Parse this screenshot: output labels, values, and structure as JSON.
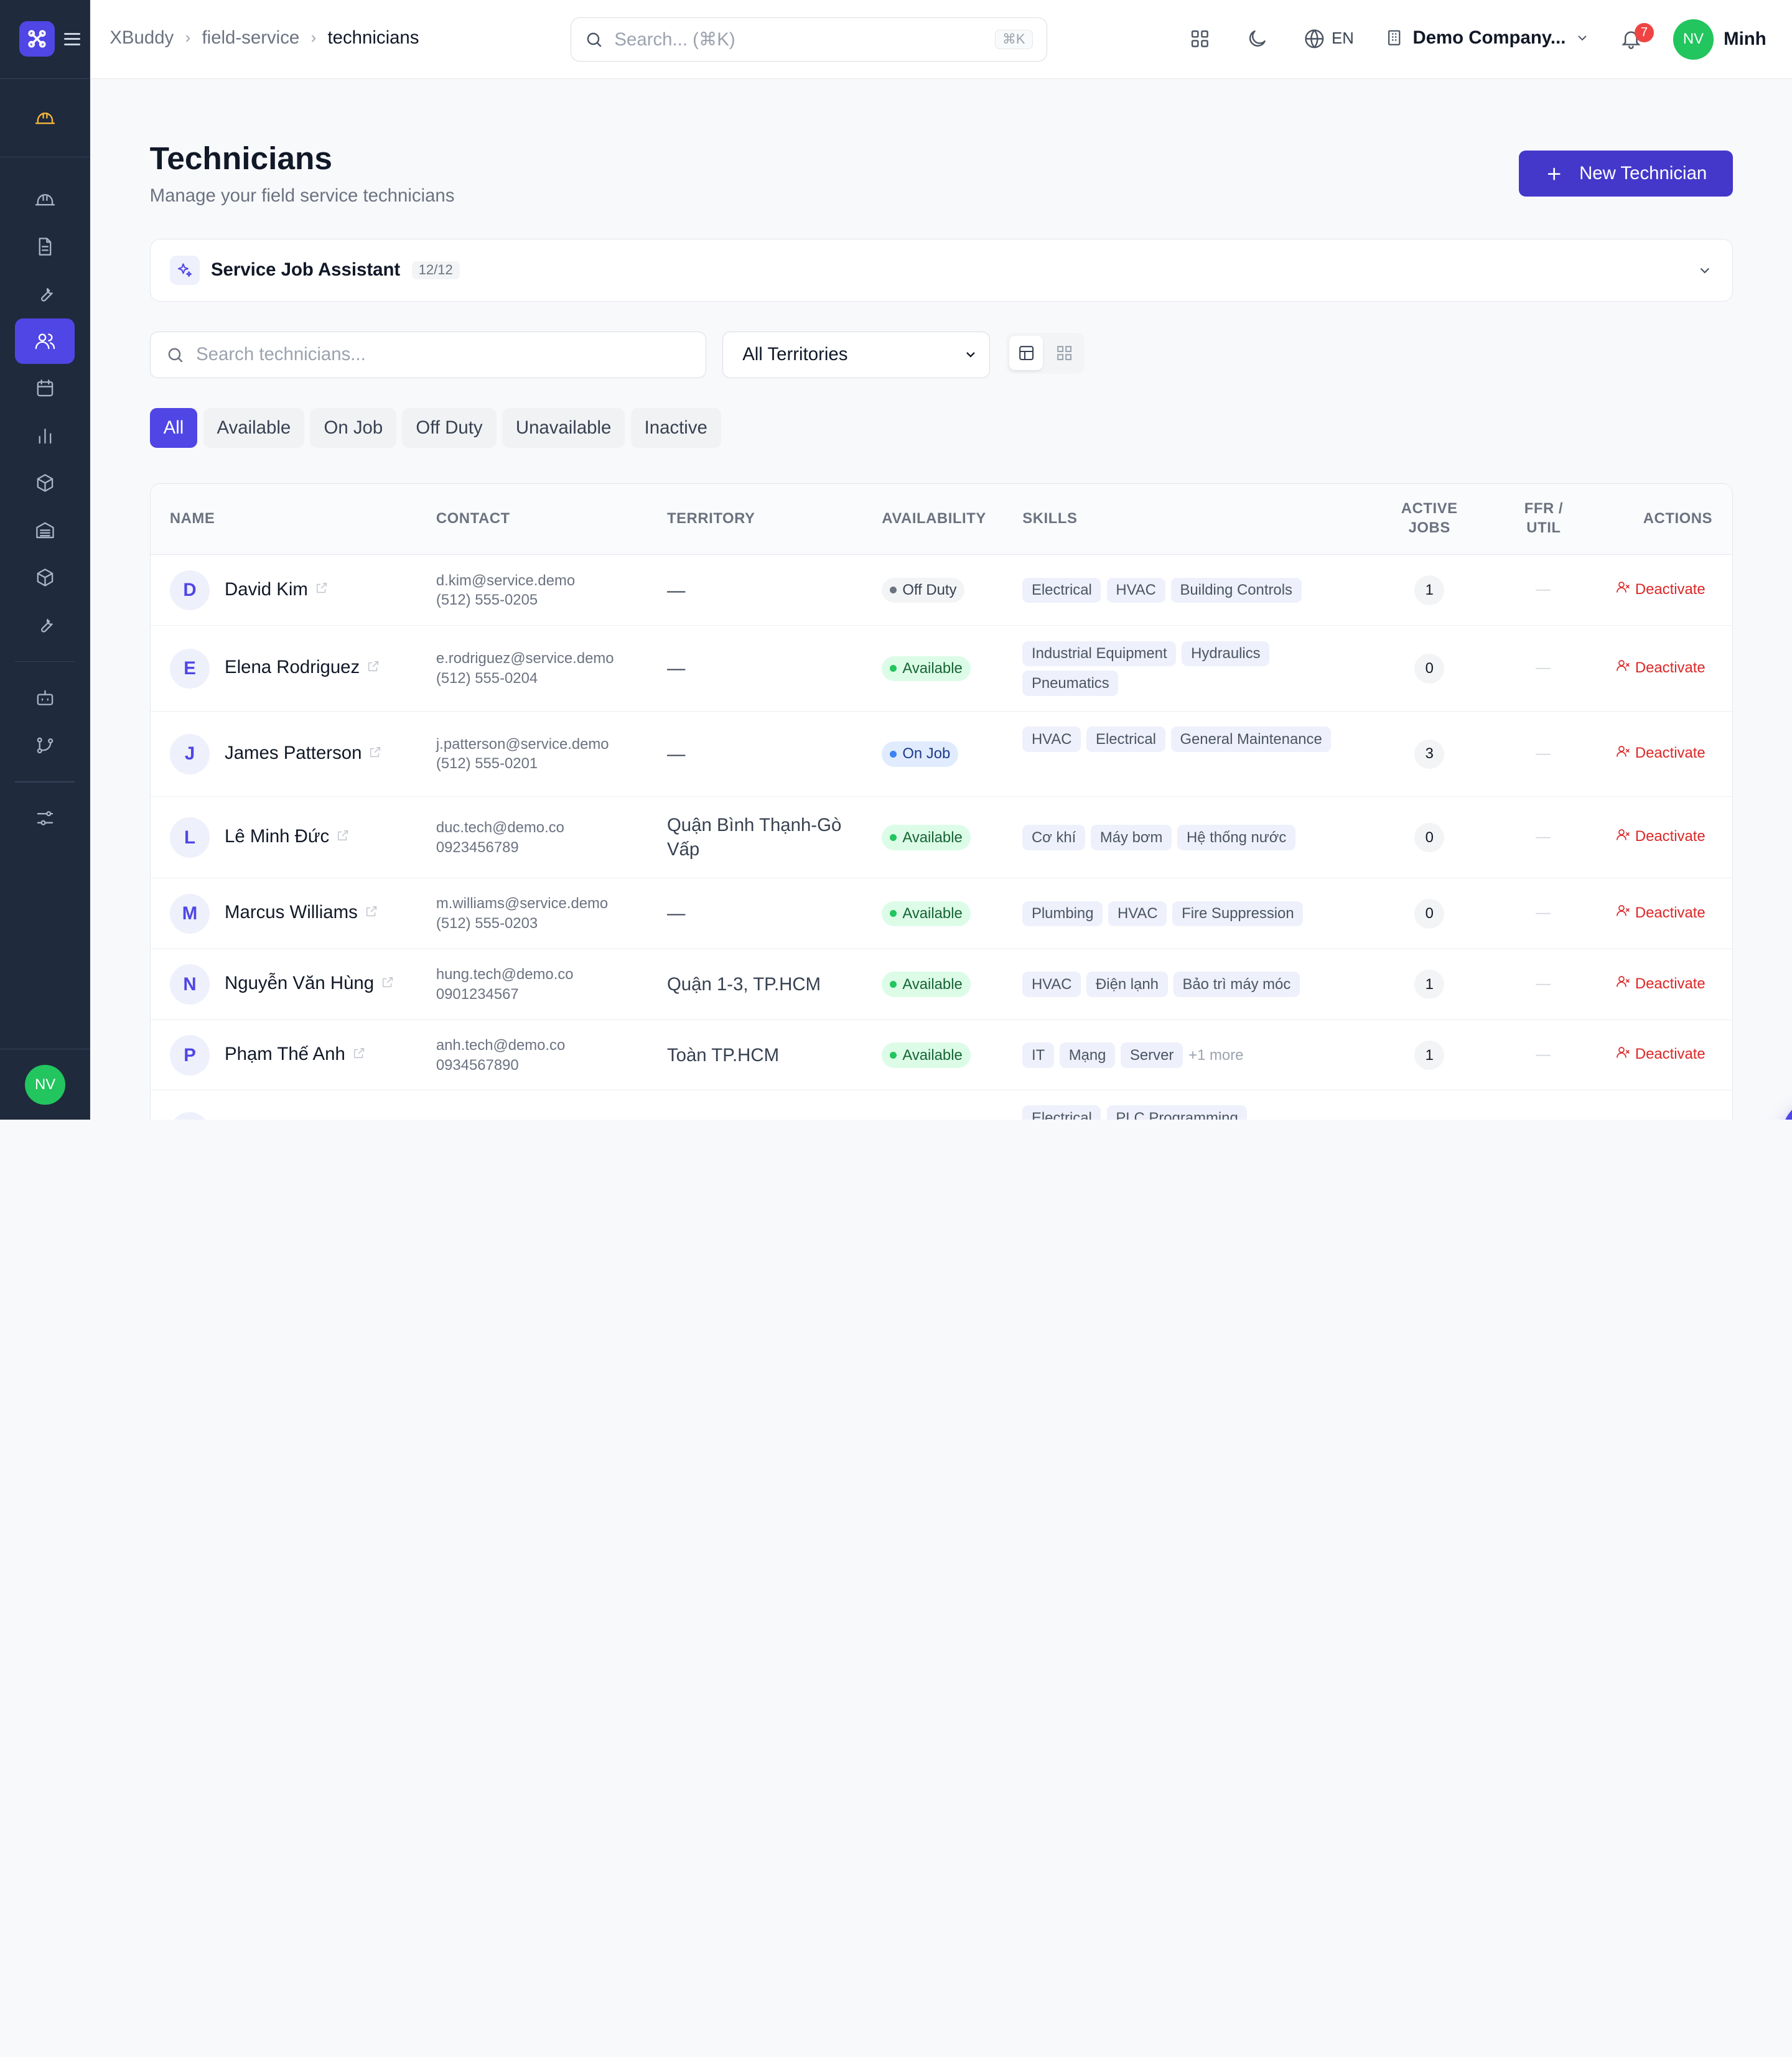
{
  "breadcrumb": [
    "XBuddy",
    "field-service",
    "technicians"
  ],
  "header": {
    "search_placeholder": "Search... (⌘K)",
    "search_kbd": "⌘K",
    "language": "EN",
    "company": "Demo Company...",
    "notifications": "7",
    "user_initials": "NV",
    "user_name": "Minh"
  },
  "sidebar": {
    "items": [
      {
        "icon": "hard-hat-icon"
      },
      {
        "icon": "clipboard-icon"
      },
      {
        "icon": "wrench-icon"
      },
      {
        "icon": "users-icon",
        "active": true
      },
      {
        "icon": "calendar-icon"
      },
      {
        "icon": "bar-chart-icon"
      },
      {
        "icon": "package-icon"
      },
      {
        "icon": "warehouse-icon"
      },
      {
        "icon": "box-icon"
      },
      {
        "icon": "tool-icon"
      },
      {
        "icon": "bot-icon"
      },
      {
        "icon": "git-branch-icon"
      },
      {
        "icon": "sliders-icon"
      }
    ],
    "user_initials": "NV"
  },
  "page": {
    "title": "Technicians",
    "subtitle": "Manage your field service technicians",
    "new_button": "New Technician"
  },
  "assistant": {
    "label": "Service Job Assistant",
    "count": "12/12"
  },
  "toolbar": {
    "search_placeholder": "Search technicians...",
    "territory_filter": "All Territories"
  },
  "filters": [
    "All",
    "Available",
    "On Job",
    "Off Duty",
    "Unavailable",
    "Inactive"
  ],
  "table": {
    "columns": {
      "name": "NAME",
      "contact": "CONTACT",
      "territory": "TERRITORY",
      "availability": "AVAILABILITY",
      "skills": "SKILLS",
      "jobs_1": "ACTIVE",
      "jobs_2": "JOBS",
      "ffr_1": "FFR /",
      "ffr_2": "UTIL",
      "actions": "ACTIONS"
    },
    "action_label": "Deactivate",
    "rows": [
      {
        "initial": "D",
        "name": "David Kim",
        "email": "d.kim@service.demo",
        "phone": "(512) 555-0205",
        "territory": "—",
        "status": "Off Duty",
        "status_kind": "offduty",
        "skills": [
          "Electrical",
          "HVAC",
          "Building Controls"
        ],
        "more": "",
        "jobs": "1",
        "ffr": "—"
      },
      {
        "initial": "E",
        "name": "Elena Rodriguez",
        "email": "e.rodriguez@service.demo",
        "phone": "(512) 555-0204",
        "territory": "—",
        "status": "Available",
        "status_kind": "available",
        "skills": [
          "Industrial Equipment",
          "Hydraulics",
          "Pneumatics"
        ],
        "more": "",
        "jobs": "0",
        "ffr": "—"
      },
      {
        "initial": "J",
        "name": "James Patterson",
        "email": "j.patterson@service.demo",
        "phone": "(512) 555-0201",
        "territory": "—",
        "status": "On Job",
        "status_kind": "onjob",
        "skills": [
          "HVAC",
          "Electrical",
          "General Maintenance"
        ],
        "more": "",
        "jobs": "3",
        "ffr": "—"
      },
      {
        "initial": "L",
        "name": "Lê Minh Đức",
        "email": "duc.tech@demo.co",
        "phone": "0923456789",
        "territory": "Quận Bình Thạnh-Gò Vấp",
        "status": "Available",
        "status_kind": "available",
        "skills": [
          "Cơ khí",
          "Máy bơm",
          "Hệ thống nước"
        ],
        "more": "",
        "jobs": "0",
        "ffr": "—"
      },
      {
        "initial": "M",
        "name": "Marcus Williams",
        "email": "m.williams@service.demo",
        "phone": "(512) 555-0203",
        "territory": "—",
        "status": "Available",
        "status_kind": "available",
        "skills": [
          "Plumbing",
          "HVAC",
          "Fire Suppression"
        ],
        "more": "",
        "jobs": "0",
        "ffr": "—"
      },
      {
        "initial": "N",
        "name": "Nguyễn Văn Hùng",
        "email": "hung.tech@demo.co",
        "phone": "0901234567",
        "territory": "Quận 1-3, TP.HCM",
        "status": "Available",
        "status_kind": "available",
        "skills": [
          "HVAC",
          "Điện lạnh",
          "Bảo trì máy móc"
        ],
        "more": "",
        "jobs": "1",
        "ffr": "—"
      },
      {
        "initial": "P",
        "name": "Phạm Thế Anh",
        "email": "anh.tech@demo.co",
        "phone": "0934567890",
        "territory": "Toàn TP.HCM",
        "status": "Available",
        "status_kind": "available",
        "skills": [
          "IT",
          "Mạng",
          "Server"
        ],
        "more": "+1 more",
        "jobs": "1",
        "ffr": "—"
      }
    ],
    "partial_row": {
      "skills": [
        "Electrical",
        "PLC Programming"
      ]
    }
  },
  "colors": {
    "primary": "#4f46e5",
    "sidebar": "#1f2a3c",
    "danger": "#dc2626",
    "available": "#22c55e"
  }
}
